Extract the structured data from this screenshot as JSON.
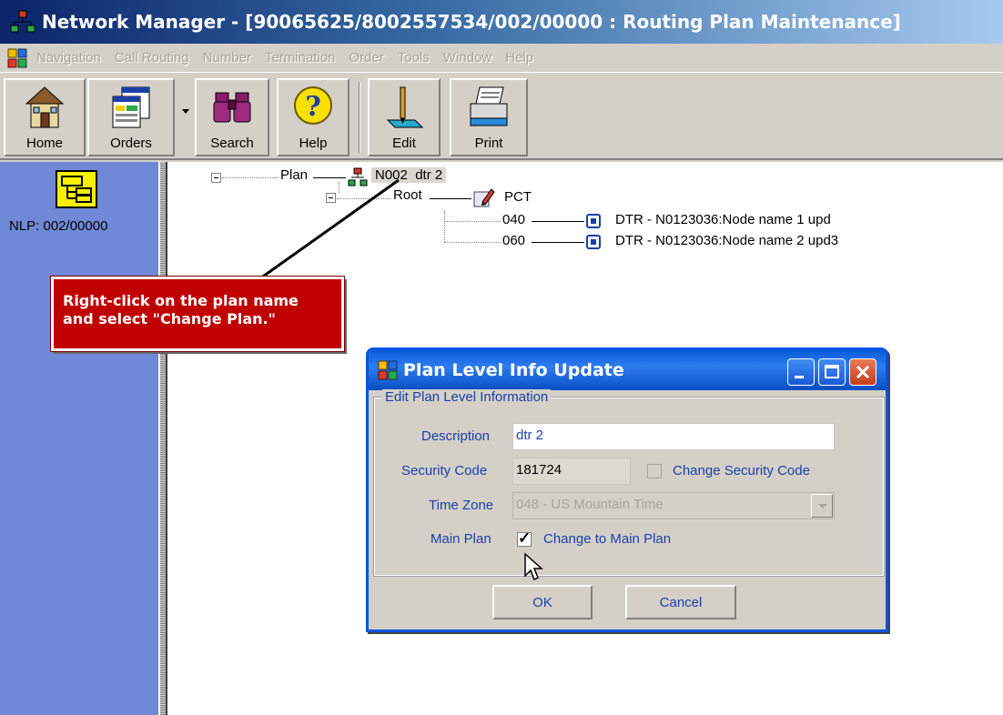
{
  "window": {
    "title": "Network Manager - [90065625/8002557534/002/00000 : Routing Plan Maintenance]"
  },
  "menu": {
    "items": [
      "Navigation",
      "Call Routing",
      "Number",
      "Termination",
      "Order",
      "Tools",
      "Window",
      "Help"
    ]
  },
  "toolbar": {
    "home": "Home",
    "orders": "Orders",
    "search": "Search",
    "help": "Help",
    "edit": "Edit",
    "print": "Print"
  },
  "sidebar": {
    "nlp_label": "NLP: 002/00000"
  },
  "tree": {
    "plan_label": "Plan",
    "plan_code": "N002",
    "plan_name": "dtr 2",
    "root_label": "Root",
    "root_value": "PCT",
    "nodes": [
      {
        "code": "040",
        "text": "DTR - N0123036:Node name 1 upd"
      },
      {
        "code": "060",
        "text": "DTR - N0123036:Node name 2 upd3"
      }
    ]
  },
  "callout": {
    "line1": "Right-click on the plan name",
    "line2": "and select \"Change Plan.\""
  },
  "dialog": {
    "title": "Plan Level Info Update",
    "group_label": "Edit Plan Level Information",
    "description_label": "Description",
    "description_value": "dtr 2",
    "security_label": "Security Code",
    "security_value": "181724",
    "change_security_label": "Change Security Code",
    "change_security_checked": false,
    "timezone_label": "Time Zone",
    "timezone_value": "048 - US Mountain Time",
    "main_plan_label": "Main Plan",
    "main_plan_checked": true,
    "change_main_label": "Change to Main Plan",
    "ok": "OK",
    "cancel": "Cancel"
  },
  "colors": {
    "title_bar": "#0a246a",
    "sidebar": "#6f89d6",
    "callout": "#c00000",
    "dialog_title": "#0a5bd8",
    "label_blue": "#1c3fa8"
  }
}
